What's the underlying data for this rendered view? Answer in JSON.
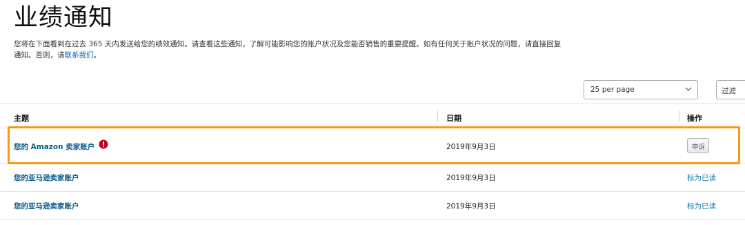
{
  "page": {
    "title": "业绩通知",
    "description_text": "您将在下面看到在过去 365 天内发送给您的绩效通知。请查看这些通知，了解可能影响您的账户状况及您能否销售的重要提醒。如有任何关于账户状况的问题，请直接回复通知。否则，请",
    "contact_link": "联系我们",
    "description_end": "。"
  },
  "controls": {
    "per_page_value": "25 per page",
    "filter_label": "过滤"
  },
  "table": {
    "headers": {
      "subject": "主题",
      "date": "日期",
      "action": "操作"
    },
    "rows": [
      {
        "subject": "您的 Amazon 卖家账户",
        "date": "2019年9月3日",
        "action": "申诉",
        "action_type": "button",
        "alert": true
      },
      {
        "subject": "您的亚马逊卖家账户",
        "date": "2019年9月3日",
        "action": "标为已读",
        "action_type": "link",
        "alert": false
      },
      {
        "subject": "您的亚马逊卖家账户",
        "date": "2019年9月3日",
        "action": "标为已读",
        "action_type": "link",
        "alert": false
      }
    ]
  },
  "colors": {
    "highlight": "#f59a12",
    "alert": "#c40022",
    "link": "#0a5a8a"
  },
  "icons": {
    "alert": "exclamation-circle-icon",
    "dropdown": "chevron-down-icon"
  }
}
